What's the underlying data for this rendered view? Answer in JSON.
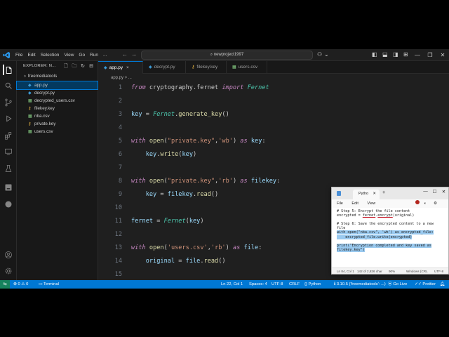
{
  "titlebar": {
    "menus": [
      "File",
      "Edit",
      "Selection",
      "View",
      "Go",
      "Run",
      "..."
    ],
    "search_text": "newproject1997"
  },
  "sidebar": {
    "header": "EXPLORER: N...",
    "folder": "freemediatools",
    "files": [
      {
        "name": "app.py",
        "icon": "python-icon",
        "selected": true
      },
      {
        "name": "decrypt.py",
        "icon": "python-icon"
      },
      {
        "name": "decrypted_users.csv",
        "icon": "csv-icon"
      },
      {
        "name": "filekey.key",
        "icon": "key-file-icon"
      },
      {
        "name": "nba.csv",
        "icon": "csv-icon"
      },
      {
        "name": "private.key",
        "icon": "key-file-icon"
      },
      {
        "name": "users.csv",
        "icon": "csv-icon"
      }
    ]
  },
  "tabs": [
    {
      "label": "app.py",
      "icon": "python-icon",
      "active": true,
      "close": "×"
    },
    {
      "label": "decrypt.py",
      "icon": "python-icon"
    },
    {
      "label": "filekey.key",
      "icon": "key-file-icon"
    },
    {
      "label": "users.csv",
      "icon": "csv-icon"
    }
  ],
  "breadcrumb": "app.py > ...",
  "editor": {
    "line_numbers": [
      "1",
      "2",
      "3",
      "4",
      "5",
      "6",
      "7",
      "8",
      "9",
      "10",
      "11",
      "12",
      "13",
      "14",
      "15"
    ],
    "lines": [
      [
        {
          "t": "from",
          "c": "kw"
        },
        {
          "t": " cryptography.fernet ",
          "c": ""
        },
        {
          "t": "import",
          "c": "kw"
        },
        {
          "t": " ",
          "c": ""
        },
        {
          "t": "Fernet",
          "c": "cls"
        }
      ],
      [],
      [
        {
          "t": "key",
          "c": "var"
        },
        {
          "t": " = ",
          "c": ""
        },
        {
          "t": "Fernet",
          "c": "cls"
        },
        {
          "t": ".",
          "c": ""
        },
        {
          "t": "generate_key",
          "c": "fn"
        },
        {
          "t": "()",
          "c": ""
        }
      ],
      [],
      [
        {
          "t": "with",
          "c": "kw"
        },
        {
          "t": " ",
          "c": ""
        },
        {
          "t": "open",
          "c": "fn"
        },
        {
          "t": "(",
          "c": ""
        },
        {
          "t": "\"private.key\"",
          "c": "str"
        },
        {
          "t": ",",
          "c": ""
        },
        {
          "t": "'wb'",
          "c": "str"
        },
        {
          "t": ") ",
          "c": ""
        },
        {
          "t": "as",
          "c": "kw"
        },
        {
          "t": " ",
          "c": ""
        },
        {
          "t": "key",
          "c": "var"
        },
        {
          "t": ":",
          "c": ""
        }
      ],
      [
        {
          "t": "    ",
          "c": ""
        },
        {
          "t": "key",
          "c": "var"
        },
        {
          "t": ".",
          "c": ""
        },
        {
          "t": "write",
          "c": "fn"
        },
        {
          "t": "(",
          "c": ""
        },
        {
          "t": "key",
          "c": "var"
        },
        {
          "t": ")",
          "c": ""
        }
      ],
      [],
      [
        {
          "t": "with",
          "c": "kw"
        },
        {
          "t": " ",
          "c": ""
        },
        {
          "t": "open",
          "c": "fn"
        },
        {
          "t": "(",
          "c": ""
        },
        {
          "t": "\"private.key\"",
          "c": "str"
        },
        {
          "t": ",",
          "c": ""
        },
        {
          "t": "'rb'",
          "c": "str"
        },
        {
          "t": ") ",
          "c": ""
        },
        {
          "t": "as",
          "c": "kw"
        },
        {
          "t": " ",
          "c": ""
        },
        {
          "t": "filekey",
          "c": "var"
        },
        {
          "t": ":",
          "c": ""
        }
      ],
      [
        {
          "t": "    ",
          "c": ""
        },
        {
          "t": "key",
          "c": "var"
        },
        {
          "t": " = ",
          "c": ""
        },
        {
          "t": "filekey",
          "c": "var"
        },
        {
          "t": ".",
          "c": ""
        },
        {
          "t": "read",
          "c": "fn"
        },
        {
          "t": "()",
          "c": ""
        }
      ],
      [],
      [
        {
          "t": "fernet",
          "c": "var"
        },
        {
          "t": " = ",
          "c": ""
        },
        {
          "t": "Fernet",
          "c": "cls"
        },
        {
          "t": "(",
          "c": ""
        },
        {
          "t": "key",
          "c": "var"
        },
        {
          "t": ")",
          "c": ""
        }
      ],
      [],
      [
        {
          "t": "with",
          "c": "kw"
        },
        {
          "t": " ",
          "c": ""
        },
        {
          "t": "open",
          "c": "fn"
        },
        {
          "t": "(",
          "c": ""
        },
        {
          "t": "'users.csv'",
          "c": "str"
        },
        {
          "t": ",",
          "c": ""
        },
        {
          "t": "'rb'",
          "c": "str"
        },
        {
          "t": ") ",
          "c": ""
        },
        {
          "t": "as",
          "c": "kw"
        },
        {
          "t": " ",
          "c": ""
        },
        {
          "t": "file",
          "c": "var"
        },
        {
          "t": ":",
          "c": ""
        }
      ],
      [
        {
          "t": "    ",
          "c": ""
        },
        {
          "t": "original",
          "c": "var"
        },
        {
          "t": " = ",
          "c": ""
        },
        {
          "t": "file",
          "c": "var"
        },
        {
          "t": ".",
          "c": ""
        },
        {
          "t": "read",
          "c": "fn"
        },
        {
          "t": "()",
          "c": ""
        }
      ],
      []
    ]
  },
  "statusbar": {
    "problems": "⊗ 0 ⚠ 0",
    "terminal": "Terminal",
    "position": "Ln 22, Col 1",
    "spaces": "Spaces: 4",
    "encoding": "UTF-8",
    "eol": "CRLF",
    "language": "Python",
    "interpreter": "3.10.5 ('freemediatools': ...)",
    "golive": "Go Live",
    "prettier": "Prettier"
  },
  "notepad": {
    "tab_title": "Pytho",
    "menu": [
      "File",
      "Edit",
      "View"
    ],
    "lines": [
      [
        {
          "t": "# Step 5: Encrypt the file content",
          "s": false
        }
      ],
      [
        {
          "t": "encrypted = ",
          "s": false
        },
        {
          "t": "fernet",
          "s": false,
          "u": true
        },
        {
          "t": ".",
          "s": false
        },
        {
          "t": "encrypt",
          "s": false,
          "u": true
        },
        {
          "t": "(original)",
          "s": false
        }
      ],
      [],
      [
        {
          "t": "# Step 6: Save the encrypted content to a new",
          "s": false
        }
      ],
      [
        {
          "t": "file",
          "s": false
        }
      ],
      [
        {
          "t": "with open(\"nba.csv\", 'wb') as encrypted_file:",
          "s": true
        }
      ],
      [
        {
          "t": "    encrypted_file.write(encrypted)",
          "s": true
        }
      ],
      [],
      [
        {
          "t": "print(\"Encryption completed and key saved as",
          "s": true
        }
      ],
      [
        {
          "t": "filekey.key\")",
          "s": true
        }
      ]
    ],
    "status": {
      "position": "Ln 84, Col 1",
      "chars": "142 of 2,826 char",
      "zoom": "90%",
      "eol": "Windows (CRL",
      "encoding": "UTF-8"
    }
  }
}
